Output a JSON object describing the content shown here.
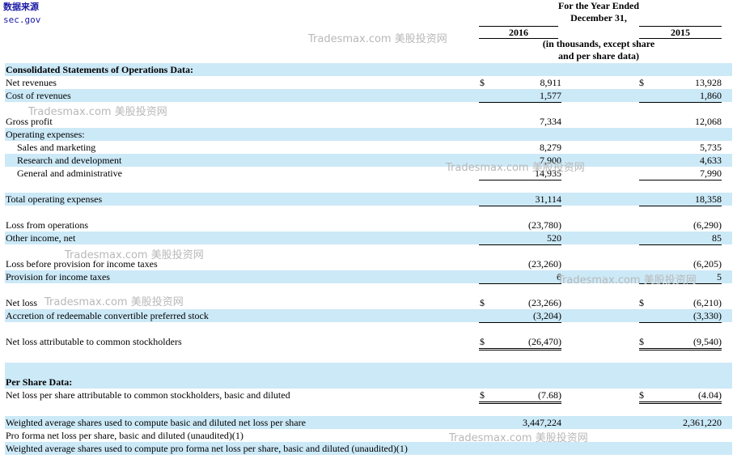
{
  "source": {
    "title": "数据来源",
    "site": "sec.gov"
  },
  "header": {
    "period_line1": "For the Year Ended",
    "period_line2": "December 31,",
    "year1": "2016",
    "year2": "2015",
    "note_line1": "(in thousands, except share",
    "note_line2": "and per share data)"
  },
  "watermark": "Tradesmax.com 美股投资网",
  "rows": [
    {
      "label": "Consolidated Statements of Operations Data:",
      "v1": "",
      "v2": ""
    },
    {
      "label": "Net revenues",
      "d1": "$",
      "v1": "8,911",
      "d2": "$",
      "v2": "13,928"
    },
    {
      "label": "Cost of revenues",
      "v1": "1,577",
      "v2": "1,860"
    },
    {
      "label": "Gross profit",
      "v1": "7,334",
      "v2": "12,068"
    },
    {
      "label": "Operating expenses:",
      "v1": "",
      "v2": ""
    },
    {
      "label": "Sales and marketing",
      "v1": "8,279",
      "v2": "5,735"
    },
    {
      "label": "Research and development",
      "v1": "7,900",
      "v2": "4,633"
    },
    {
      "label": "General and administrative",
      "v1": "14,935",
      "v2": "7,990"
    },
    {
      "label": "Total operating expenses",
      "v1": "31,114",
      "v2": "18,358"
    },
    {
      "label": "Loss from operations",
      "v1": "(23,780)",
      "v2": "(6,290)"
    },
    {
      "label": "Other income, net",
      "v1": "520",
      "v2": "85"
    },
    {
      "label": "Loss before provision for income taxes",
      "v1": "(23,260)",
      "v2": "(6,205)"
    },
    {
      "label": "Provision for income taxes",
      "v1": "6",
      "v2": "5"
    },
    {
      "label": "Net loss",
      "d1": "$",
      "v1": "(23,266)",
      "d2": "$",
      "v2": "(6,210)"
    },
    {
      "label": "Accretion of redeemable convertible preferred stock",
      "v1": "(3,204)",
      "v2": "(3,330)"
    },
    {
      "label": "Net loss attributable to common stockholders",
      "d1": "$",
      "v1": "(26,470)",
      "d2": "$",
      "v2": "(9,540)"
    },
    {
      "label": "Per Share Data:",
      "v1": "",
      "v2": ""
    },
    {
      "label": "Net loss per share attributable to common stockholders, basic and diluted",
      "d1": "$",
      "v1": "(7.68)",
      "d2": "$",
      "v2": "(4.04)"
    },
    {
      "label": "Weighted average shares used to compute basic and diluted net loss per share",
      "v1": "3,447,224",
      "v2": "2,361,220"
    },
    {
      "label": "Pro forma net loss per share, basic and diluted (unaudited)(1)",
      "v1": "",
      "v2": ""
    },
    {
      "label": "Weighted average shares used to compute pro forma net loss per share, basic and diluted (unaudited)(1)",
      "v1": "",
      "v2": ""
    }
  ]
}
